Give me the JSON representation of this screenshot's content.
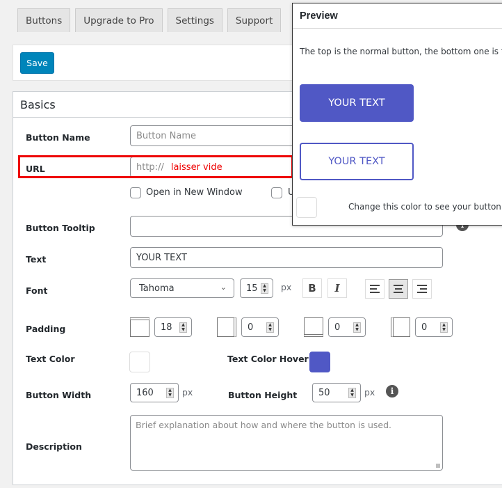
{
  "tabs": [
    "Buttons",
    "Upgrade to Pro",
    "Settings",
    "Support"
  ],
  "save_label": "Save",
  "section_title": "Basics",
  "fields": {
    "button_name": {
      "label": "Button Name",
      "placeholder": "Button Name",
      "value": ""
    },
    "url": {
      "label": "URL",
      "placeholder": "http://",
      "annotation": "laisser vide"
    },
    "open_new_window": {
      "label": "Open in New Window",
      "checked": false
    },
    "second_checkbox": {
      "label": "U",
      "checked": false
    },
    "tooltip": {
      "label": "Button Tooltip",
      "value": ""
    },
    "text": {
      "label": "Text",
      "value": "YOUR TEXT"
    },
    "font": {
      "label": "Font",
      "family": "Tahoma",
      "size": "15",
      "unit": "px",
      "bold_label": "B",
      "italic_label": "I",
      "alignment": "center"
    },
    "padding": {
      "label": "Padding",
      "top": "18",
      "right": "0",
      "bottom": "0",
      "left": "0"
    },
    "text_color": {
      "label": "Text Color",
      "value": "#ffffff"
    },
    "text_color_hover": {
      "label": "Text Color Hover",
      "value": "#5058c5"
    },
    "button_width": {
      "label": "Button Width",
      "value": "160",
      "unit": "px"
    },
    "button_height": {
      "label": "Button Height",
      "value": "50",
      "unit": "px"
    },
    "description": {
      "label": "Description",
      "placeholder": "Brief explanation about how and where the button is used."
    }
  },
  "preview": {
    "title": "Preview",
    "description": "The top is the normal button, the bottom one is the hover button.",
    "normal_text": "YOUR TEXT",
    "hover_text": "YOUR TEXT",
    "bg_label": "Change this color to see your button on different backgrounds"
  },
  "colors": {
    "accent": "#0085ba",
    "button": "#5058c5",
    "highlight": "#ee0000"
  }
}
